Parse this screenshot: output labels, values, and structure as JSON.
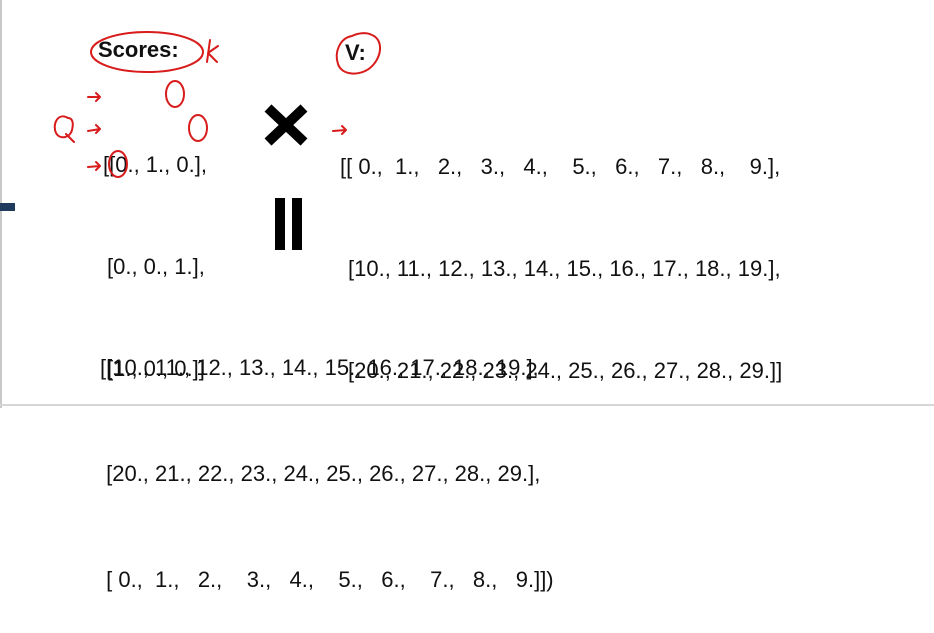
{
  "scores": {
    "label": "Scores:",
    "rows": [
      "[[0., 1., 0.],",
      "[0., 0., 1.],",
      "[1., 0., 0.]]"
    ]
  },
  "values": {
    "label": "V:",
    "rows": [
      "[[ 0.,  1.,   2.,   3.,   4.,    5.,   6.,   7.,   8.,    9.],",
      "[10., 11., 12., 13., 14., 15., 16., 17., 18., 19.],",
      "[20., 21., 22., 23., 24., 25., 26., 27., 28., 29.]]"
    ]
  },
  "result": {
    "rows": [
      "[[10., 11., 12., 13., 14., 15., 16., 17., 18., 19.],",
      " [20., 21., 22., 23., 24., 25., 26., 27., 28., 29.],",
      " [ 0.,  1.,   2.,    3.,   4.,    5.,   6.,    7.,   8.,   9.]])"
    ]
  },
  "annotations": {
    "k_mark": "k",
    "q_mark": "Q",
    "ink_color": "#d81b1b"
  },
  "icons": {
    "times": "multiply-icon",
    "equals": "equals-icon"
  }
}
